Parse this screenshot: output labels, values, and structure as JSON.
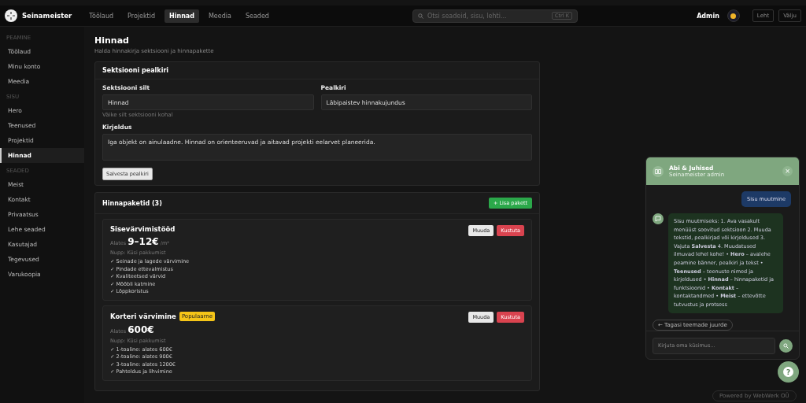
{
  "topbar": {
    "brand": "Seinameister",
    "nav": [
      {
        "label": "Töölaud",
        "selected": false
      },
      {
        "label": "Projektid",
        "selected": false
      },
      {
        "label": "Hinnad",
        "selected": true
      },
      {
        "label": "Meedia",
        "selected": false
      },
      {
        "label": "Seaded",
        "selected": false
      }
    ],
    "search": {
      "placeholder": "Otsi seadeid, sisu, lehti...",
      "shortcut": "Ctrl K"
    },
    "user": "Admin",
    "buttons": [
      "Leht",
      "Välju"
    ]
  },
  "sidebar": {
    "groups": [
      {
        "title": "PEAMINE",
        "items": [
          {
            "label": "Töölaud",
            "selected": false
          },
          {
            "label": "Minu konto",
            "selected": false
          },
          {
            "label": "Meedia",
            "selected": false
          }
        ]
      },
      {
        "title": "SISU",
        "items": [
          {
            "label": "Hero",
            "selected": false
          },
          {
            "label": "Teenused",
            "selected": false
          },
          {
            "label": "Projektid",
            "selected": false
          },
          {
            "label": "Hinnad",
            "selected": true
          }
        ]
      },
      {
        "title": "SEADED",
        "items": [
          {
            "label": "Meist",
            "selected": false
          },
          {
            "label": "Kontakt",
            "selected": false
          },
          {
            "label": "Privaatsus",
            "selected": false
          },
          {
            "label": "Lehe seaded",
            "selected": false
          },
          {
            "label": "Kasutajad",
            "selected": false
          },
          {
            "label": "Tegevused",
            "selected": false
          },
          {
            "label": "Varukoopia",
            "selected": false
          }
        ]
      }
    ]
  },
  "page": {
    "title": "Hinnad",
    "subtitle": "Halda hinnakirja sektsiooni ja hinnapakette"
  },
  "section_card": {
    "title": "Sektsiooni pealkiri",
    "label_field": {
      "label": "Sektsiooni silt",
      "value": "Hinnad",
      "hint": "Väike silt sektsiooni kohal"
    },
    "heading_field": {
      "label": "Pealkiri",
      "value": "Läbipaistev hinnakujundus"
    },
    "description_field": {
      "label": "Kirjeldus",
      "value": "Iga objekt on ainulaadne. Hinnad on orienteeruvad ja aitavad projekti eelarvet planeerida."
    },
    "save_button": "Salvesta pealkiri"
  },
  "packages_card": {
    "title": "Hinnapaketid (3)",
    "add_button": "+ Lisa pakett",
    "packages": [
      {
        "name": "Sisevärvimistööd",
        "prefix": "Alates",
        "price": "9–12€",
        "unit": "/m²",
        "button_text": "Nupp: Küsi pakkumist",
        "features": [
          "✓ Seinade ja lagede värvimine",
          "✓ Pindade ettevalmistus",
          "✓ Kvaliteetsed värvid",
          "✓ Mööbli katmine",
          "✓ Lõppkoristus"
        ],
        "edit": "Muuda",
        "delete": "Kustuta"
      },
      {
        "name": "Korteri värvimine",
        "badge": "Populaarne",
        "prefix": "Alates",
        "price": "600€",
        "button_text": "Nupp: Küsi pakkumist",
        "features": [
          "✓ 1-toaline: alates 600€",
          "✓ 2-toaline: alates 900€",
          "✓ 3-toaline: alates 1200€",
          "✓ Pahteldus ja lihvimine"
        ],
        "edit": "Muuda",
        "delete": "Kustuta"
      }
    ]
  },
  "chat": {
    "title": "Abi & Juhised",
    "subtitle": "Seinameister admin",
    "close": "×",
    "messages": [
      {
        "kind": "user",
        "text": "Sisu muutmine"
      },
      {
        "kind": "bot",
        "text": "Sisu muutmiseks: 1. Ava vasakult menüüst soovitud sektsioon 2. Muuda tekstid, pealkirjad või kirjeldused 3. Vajuta **Salvesta** 4. Muudatused ilmuvad lehel kohe! • **Hero** – avalehe peamine bänner, pealkiri ja tekst • **Teenused** – teenuste nimed ja kirjeldused • **Hinnad** – hinnapaketid ja funktsioonid • **Kontakt** – kontaktandmed • **Meist** – ettevõtte tutvustus ja protsess"
      }
    ],
    "back_button": "← Tagasi teemade juurde",
    "input_placeholder": "Kirjuta oma küsimus..."
  },
  "help_button": "?",
  "powered_by": "Powered by WebWerk OÜ"
}
